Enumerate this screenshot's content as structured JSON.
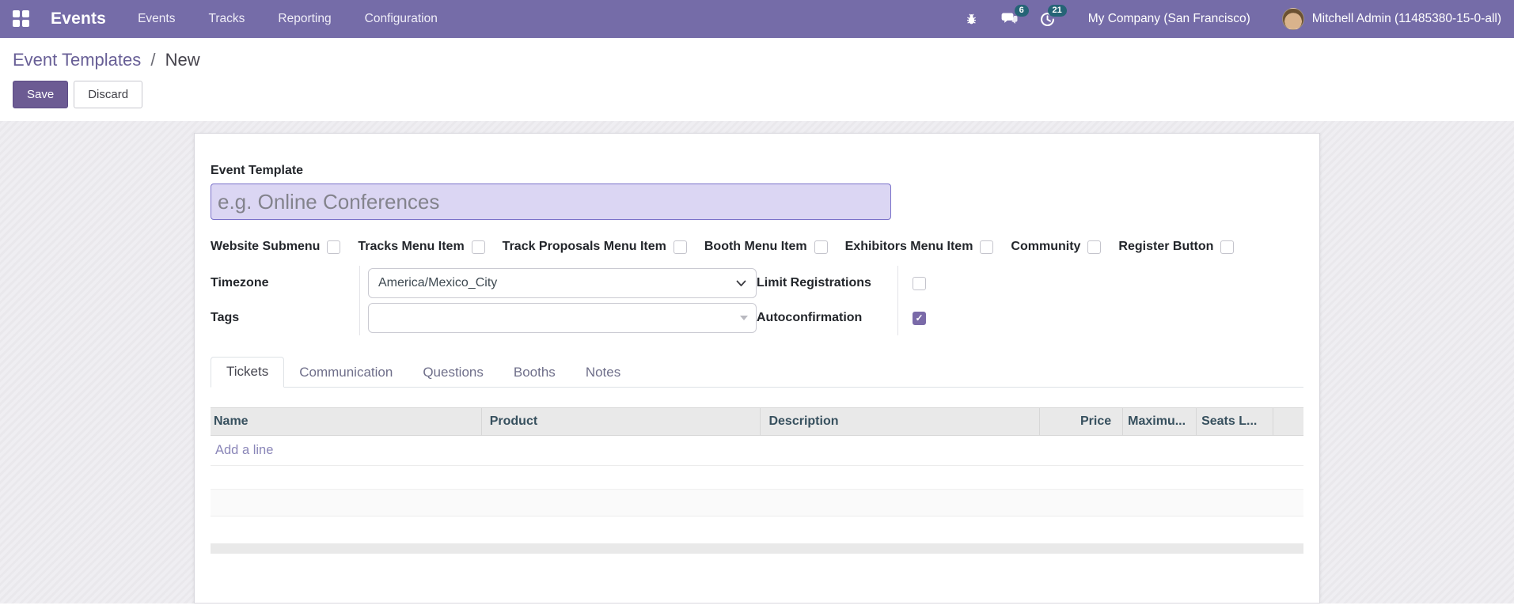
{
  "theme": {
    "primary": "#756CA8",
    "badge": "#256476",
    "btn": "#6C5B93",
    "link": "#685F96",
    "addline": "#8A86B8",
    "checked": "#7A6AA8",
    "headertext": "#37505E"
  },
  "navbar": {
    "brand": "Events",
    "menu_items": [
      {
        "label": "Events"
      },
      {
        "label": "Tracks"
      },
      {
        "label": "Reporting"
      },
      {
        "label": "Configuration"
      }
    ],
    "systray": {
      "message_badge": "6",
      "activity_badge": "21",
      "company": "My Company (San Francisco)",
      "user": "Mitchell Admin (11485380-15-0-all)"
    }
  },
  "control_panel": {
    "breadcrumb": {
      "parent": "Event Templates",
      "separator": "/",
      "current": "New"
    },
    "save_label": "Save",
    "discard_label": "Discard"
  },
  "form": {
    "title_label": "Event Template",
    "title_placeholder": "e.g. Online Conferences",
    "title_value": "",
    "checkboxes": [
      {
        "label": "Website Submenu",
        "checked": false
      },
      {
        "label": "Tracks Menu Item",
        "checked": false
      },
      {
        "label": "Track Proposals Menu Item",
        "checked": false
      },
      {
        "label": "Booth Menu Item",
        "checked": false
      },
      {
        "label": "Exhibitors Menu Item",
        "checked": false
      },
      {
        "label": "Community",
        "checked": false
      },
      {
        "label": "Register Button",
        "checked": false
      }
    ],
    "fields": {
      "timezone": {
        "label": "Timezone",
        "value": "America/Mexico_City"
      },
      "tags": {
        "label": "Tags",
        "value": ""
      },
      "limit_registrations": {
        "label": "Limit Registrations",
        "checked": false
      },
      "autoconfirmation": {
        "label": "Autoconfirmation",
        "checked": true
      }
    },
    "tabs": [
      {
        "label": "Tickets",
        "active": true
      },
      {
        "label": "Communication",
        "active": false
      },
      {
        "label": "Questions",
        "active": false
      },
      {
        "label": "Booths",
        "active": false
      },
      {
        "label": "Notes",
        "active": false
      }
    ],
    "tickets_table": {
      "columns": [
        "Name",
        "Product",
        "Description",
        "Price",
        "Maximu...",
        "Seats L..."
      ],
      "add_line_label": "Add a line",
      "rows": []
    }
  }
}
